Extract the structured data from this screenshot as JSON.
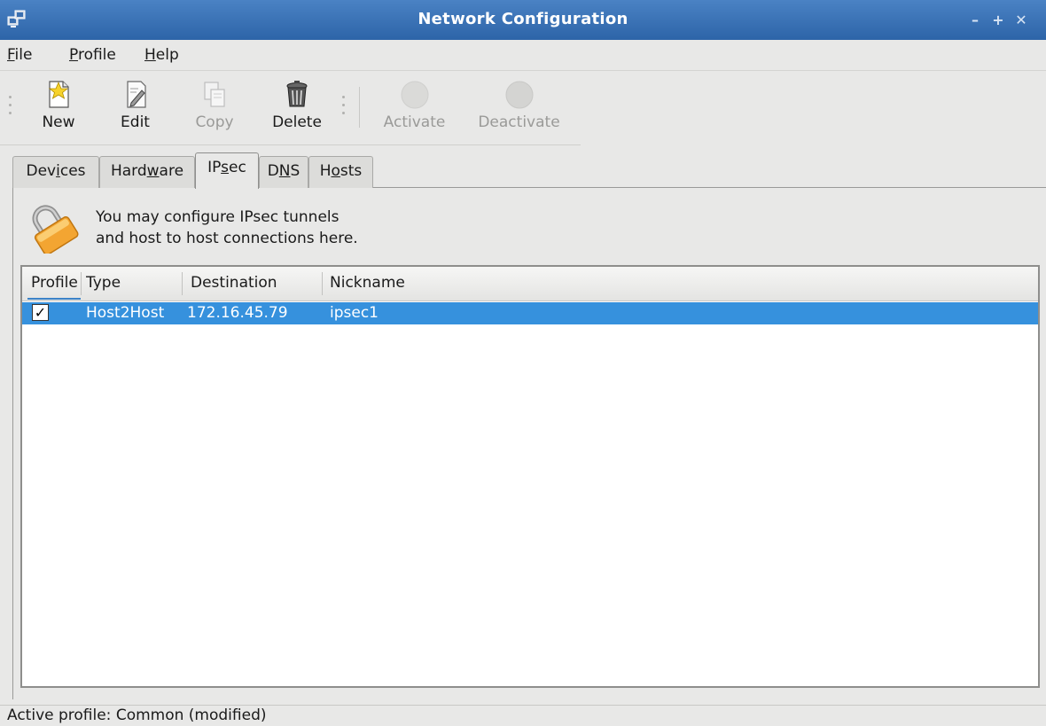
{
  "window": {
    "title": "Network Configuration"
  },
  "menu": {
    "file": {
      "mnemonic": "F",
      "rest": "ile"
    },
    "profile": {
      "mnemonic": "P",
      "rest": "rofile"
    },
    "help": {
      "mnemonic": "H",
      "rest": "elp"
    }
  },
  "toolbar": {
    "new_label": "New",
    "edit_label": "Edit",
    "copy_label": "Copy",
    "delete_label": "Delete",
    "activate_label": "Activate",
    "deactivate_label": "Deactivate"
  },
  "tabs": {
    "devices": {
      "pre": "Dev",
      "mn": "i",
      "post": "ces"
    },
    "hardware": {
      "pre": "Hard",
      "mn": "w",
      "post": "are"
    },
    "ipsec": {
      "pre": "IP",
      "mn": "s",
      "post": "ec"
    },
    "dns": {
      "pre": "D",
      "mn": "N",
      "post": "S"
    },
    "hosts": {
      "pre": "H",
      "mn": "o",
      "post": "sts"
    },
    "active": "IPsec"
  },
  "info": {
    "line1": "You may configure IPsec tunnels",
    "line2": "and host to host connections here."
  },
  "list": {
    "columns": {
      "profile": "Profile",
      "type": "Type",
      "destination": "Destination",
      "nickname": "Nickname"
    },
    "rows": [
      {
        "profile_checked": true,
        "type": "Host2Host",
        "destination": "172.16.45.79",
        "nickname": "ipsec1"
      }
    ]
  },
  "status": {
    "text": "Active profile: Common (modified)"
  },
  "icons": {
    "app": "network-computers-icon",
    "new": "new-document-star-icon",
    "edit": "edit-document-icon",
    "copy": "copy-document-icon",
    "delete": "trash-can-icon",
    "activate": "activate-circle-icon",
    "deactivate": "deactivate-circle-icon",
    "info": "padlock-icon"
  },
  "colors": {
    "titlebar": "#2d64a8",
    "selection": "#3691dd",
    "padlock": "#f0a030"
  }
}
